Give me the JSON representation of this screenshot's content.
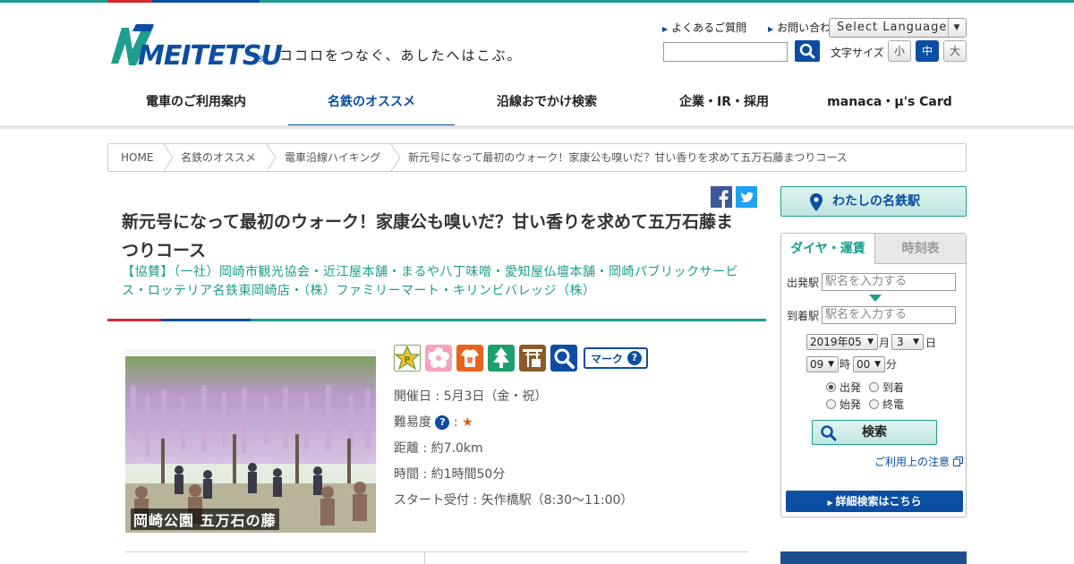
{
  "header": {
    "logo_text": "MEITETSU",
    "tagline": "ココロをつなぐ、あしたへはこぶ。",
    "links": [
      "よくあるご質問",
      "お問い合わせ"
    ],
    "language_label": "Select Language",
    "fontsize_label": "文字サイズ",
    "fontsize_options": [
      "小",
      "中",
      "大"
    ]
  },
  "nav": {
    "items": [
      "電車のご利用案内",
      "名鉄のオススメ",
      "沿線おでかけ検索",
      "企業・IR・採用",
      "manaca・μ's Card"
    ]
  },
  "breadcrumb": [
    "HOME",
    "名鉄のオススメ",
    "電車沿線ハイキング",
    "新元号になって最初のウォーク！家康公も嗅いだ？甘い香りを求めて五万石藤まつりコース"
  ],
  "article": {
    "title": "新元号になって最初のウォーク！家康公も嗅いだ？甘い香りを求めて五万石藤まつりコース",
    "sponsor": "【協賛】（一社）岡崎市観光協会・近江屋本舗・まるや八丁味噌・愛知屋仏壇本舗・岡崎パブリックサービス・ロッテリア名鉄東岡崎店・（株）ファミリーマート・キリンビバレッジ（株）",
    "photo_caption": "岡崎公園 五万石の藤",
    "mark_label": "マーク",
    "date": "開催日 : 5月3日（金・祝）",
    "difficulty_label": "難易度",
    "difficulty_stars": "★",
    "distance": "距離 : 約7.0km",
    "time": "時間 : 約1時間50分",
    "start": "スタート受付 : 矢作橋駅（8:30～11:00）"
  },
  "sidebar": {
    "my_station": "わたしの名鉄駅",
    "tabs": [
      "ダイヤ・運賃",
      "時刻表"
    ],
    "from_label": "出発駅",
    "to_label": "到着駅",
    "station_placeholder": "駅名を入力する",
    "year_month": "2019年05",
    "month_unit": "月",
    "day": "3",
    "day_unit": "日",
    "hour": "09",
    "hour_unit": "時",
    "minute": "00",
    "minute_unit": "分",
    "radio": [
      "出発",
      "到着",
      "始発",
      "終電"
    ],
    "search_label": "検索",
    "note_link": "ご利用上の注意",
    "detail_link": "詳細検索はこちら"
  },
  "colors": {
    "brand_blue": "#0b4ea2",
    "brand_teal": "#1e9e8e",
    "brand_red": "#d7282f"
  }
}
